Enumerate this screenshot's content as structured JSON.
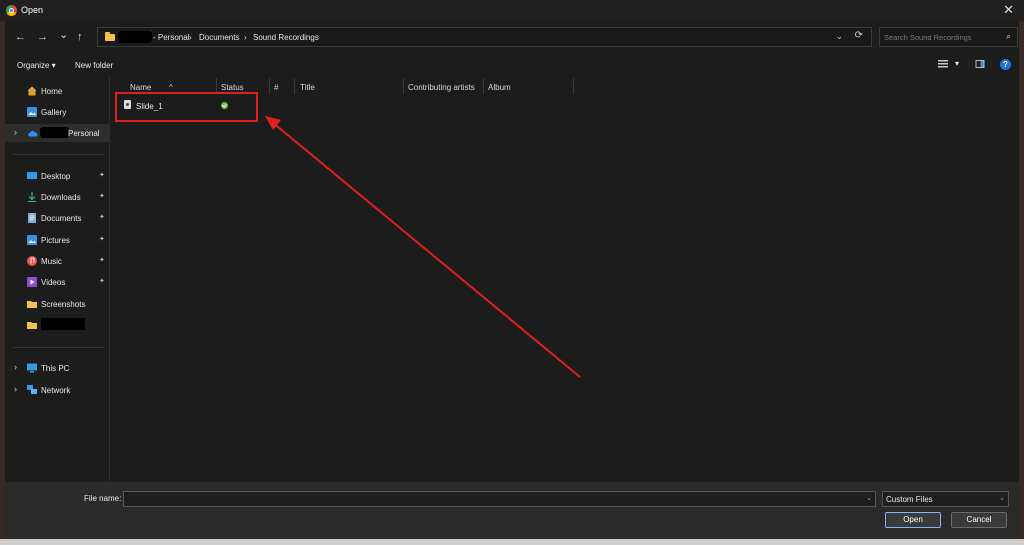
{
  "window": {
    "title": "Open",
    "close_glyph": "✕"
  },
  "navigation": {
    "back": "←",
    "forward": "→",
    "recent": "⌄",
    "up": "↑",
    "address": {
      "crumbs": [
        "- Personal",
        "›",
        "Documents",
        "›",
        "Sound Recordings"
      ],
      "dropdown_glyph": "⌄",
      "refresh_glyph": "⟳"
    },
    "search": {
      "placeholder": "Search Sound Recordings",
      "icon": "search-icon"
    }
  },
  "command_bar": {
    "organize": "Organize ▾",
    "new_folder": "New folder",
    "help": "?"
  },
  "sidebar": {
    "top_items": [
      {
        "label": "Home",
        "icon": "home-icon"
      },
      {
        "label": "Gallery",
        "icon": "gallery-icon"
      },
      {
        "label": "Personal",
        "icon": "onedrive-icon",
        "expand": "›"
      }
    ],
    "quick_access": [
      {
        "label": "Desktop",
        "icon": "desktop-icon",
        "pin": "📌"
      },
      {
        "label": "Downloads",
        "icon": "downloads-icon",
        "pin": "📌"
      },
      {
        "label": "Documents",
        "icon": "documents-icon",
        "pin": "📌"
      },
      {
        "label": "Pictures",
        "icon": "pictures-icon",
        "pin": "📌"
      },
      {
        "label": "Music",
        "icon": "music-icon",
        "pin": "📌"
      },
      {
        "label": "Videos",
        "icon": "videos-icon",
        "pin": "📌"
      },
      {
        "label": "Screenshots",
        "icon": "folder-icon"
      }
    ],
    "devices": [
      {
        "label": "This PC",
        "icon": "pc-icon",
        "expand": "›"
      },
      {
        "label": "Network",
        "icon": "network-icon",
        "expand": "›"
      }
    ]
  },
  "file_list": {
    "columns": [
      "Name",
      "Status",
      "#",
      "Title",
      "Contributing artists",
      "Album"
    ],
    "sort_glyph": "^",
    "files": [
      {
        "name": "Slide_1",
        "status": "synced"
      }
    ]
  },
  "footer": {
    "file_name_label": "File name:",
    "file_name_value": "",
    "file_type": "Custom Files",
    "open_label": "Open",
    "cancel_label": "Cancel"
  },
  "colors": {
    "background": "#1c1c1c",
    "annotation": "#e0201f",
    "accent": "#1e73d8"
  }
}
